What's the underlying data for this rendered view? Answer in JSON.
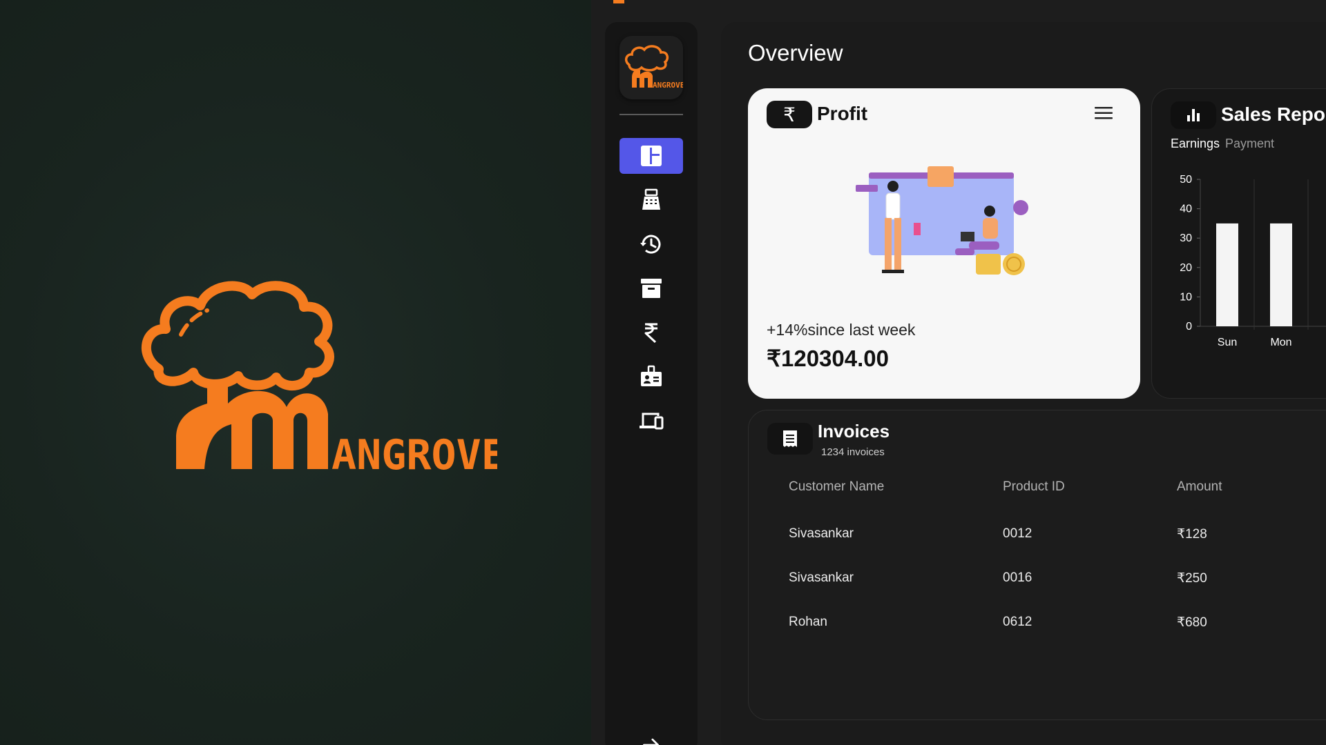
{
  "brand": {
    "name": "ANGROVE",
    "logo_text": "MANGROVE",
    "accent_color": "#f57c1f"
  },
  "sidebar": {
    "items": [
      {
        "icon": "dashboard-icon",
        "active": true
      },
      {
        "icon": "billing-machine-icon",
        "active": false
      },
      {
        "icon": "history-icon",
        "active": false
      },
      {
        "icon": "archive-icon",
        "active": false
      },
      {
        "icon": "rupee-icon",
        "active": false
      },
      {
        "icon": "employee-badge-icon",
        "active": false
      },
      {
        "icon": "devices-icon",
        "active": false
      }
    ],
    "expand_icon": "arrow-right-icon",
    "active_color": "#5457e8"
  },
  "page": {
    "title": "Overview"
  },
  "profit": {
    "badge_symbol": "₹",
    "title": "Profit",
    "change_text": "+14%since last week",
    "amount": "₹120304.00"
  },
  "sales_report": {
    "title": "Sales Report",
    "tabs": [
      "Earnings",
      "Payment"
    ],
    "active_tab": "Earnings"
  },
  "chart_data": {
    "type": "bar",
    "categories": [
      "Sun",
      "Mon"
    ],
    "values": [
      35,
      35
    ],
    "ylim": [
      0,
      50
    ],
    "yticks": [
      "0",
      "10",
      "20",
      "30",
      "40",
      "50"
    ],
    "grid": true
  },
  "invoices": {
    "title": "Invoices",
    "count_text": "1234 invoices",
    "columns": [
      "Customer Name",
      "Product ID",
      "Amount"
    ],
    "rows": [
      [
        "Sivasankar",
        "0012",
        "₹128"
      ],
      [
        "Sivasankar",
        "0016",
        "₹250"
      ],
      [
        "Rohan",
        "0612",
        "₹680"
      ]
    ]
  }
}
